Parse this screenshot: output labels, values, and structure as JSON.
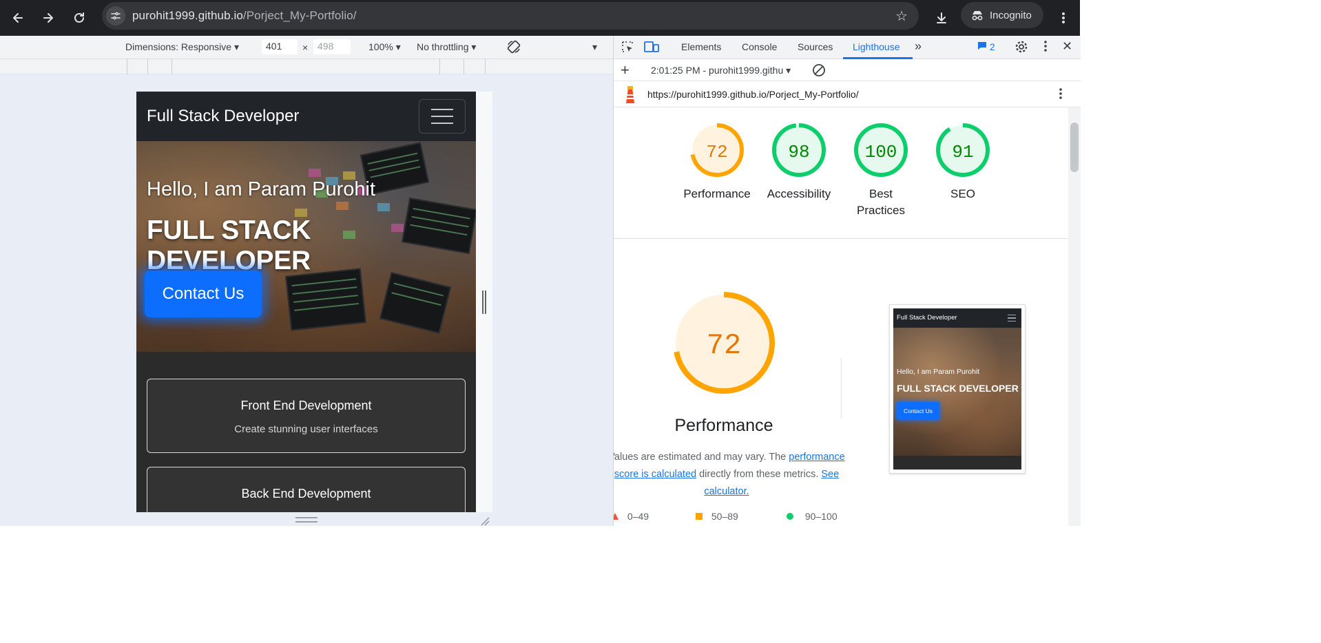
{
  "browser": {
    "url_host": "purohit1999.github.io",
    "url_path": "/Porject_My-Portfolio/",
    "incognito_label": "Incognito"
  },
  "device_toolbar": {
    "dimensions_label": "Dimensions: Responsive",
    "width": "401",
    "height_placeholder": "498",
    "zoom": "100%",
    "throttling": "No throttling"
  },
  "site": {
    "brand": "Full Stack Developer",
    "hero_hello": "Hello, I am Param Purohit",
    "hero_title": "FULL STACK DEVELOPER",
    "cta_label": "Contact Us",
    "services": [
      {
        "title": "Front End Development",
        "subtitle": "Create stunning user interfaces"
      },
      {
        "title": "Back End Development",
        "subtitle": ""
      }
    ]
  },
  "devtools": {
    "tabs": [
      "Elements",
      "Console",
      "Sources",
      "Lighthouse"
    ],
    "active_tab": "Lighthouse",
    "issues_count": "2",
    "report_label": "2:01:25 PM - purohit1999.githu",
    "report_url": "https://purohit1999.github.io/Porject_My-Portfolio/"
  },
  "lighthouse": {
    "scores": [
      {
        "label": "Performance",
        "value": "72",
        "score": 0.72,
        "color": "#e67700",
        "ring": "#ffa400",
        "fill": "#fff3e0"
      },
      {
        "label": "Accessibility",
        "value": "98",
        "score": 0.98,
        "color": "#008800",
        "ring": "#0cce6b",
        "fill": "#e6f9ee"
      },
      {
        "label": "Best Practices",
        "value": "100",
        "score": 1.0,
        "color": "#008800",
        "ring": "#0cce6b",
        "fill": "#e6f9ee"
      },
      {
        "label": "SEO",
        "value": "91",
        "score": 0.91,
        "color": "#008800",
        "ring": "#0cce6b",
        "fill": "#e6f9ee"
      }
    ],
    "big_score": "72",
    "big_score_fraction": 0.72,
    "big_label": "Performance",
    "desc_prefix": "Values are estimated and may vary. The ",
    "desc_link": "performance score is calculated",
    "desc_middle": " directly from these metrics. ",
    "desc_link2": "See calculator.",
    "legend": [
      {
        "range": "0–49",
        "color": "#ff4e42"
      },
      {
        "range": "50–89",
        "color": "#ffa400"
      },
      {
        "range": "90–100",
        "color": "#0cce6b"
      }
    ],
    "thumbnail": {
      "brand": "Full Stack Developer",
      "hello": "Hello, I am Param Purohit",
      "title": "FULL STACK DEVELOPER",
      "cta": "Contact Us"
    }
  }
}
